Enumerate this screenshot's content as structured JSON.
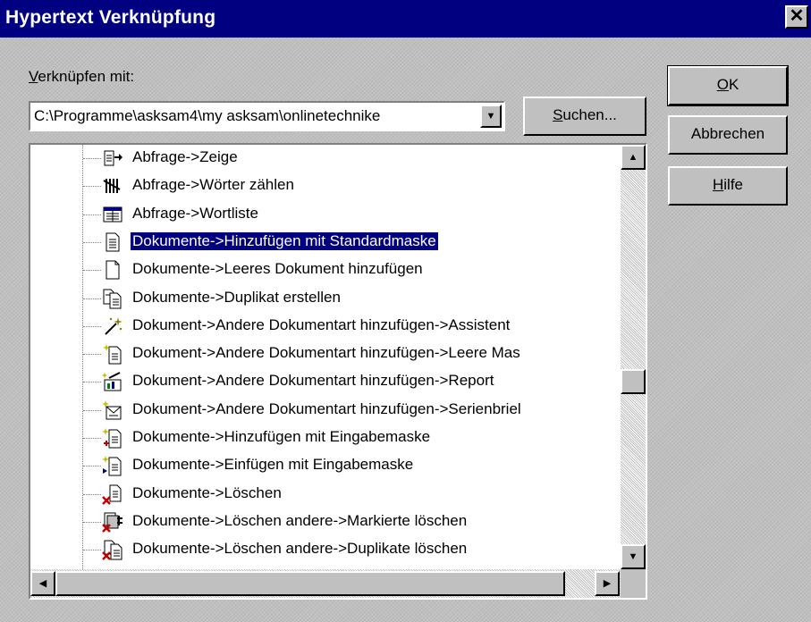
{
  "dialog": {
    "title": "Hypertext Verknüpfung",
    "close_glyph": "✕"
  },
  "verknuepfen": {
    "label": "Verknüpfen mit:",
    "value": "C:\\Programme\\asksam4\\my asksam\\onlinetechnike"
  },
  "buttons": {
    "ok": "OK",
    "abbrechen": "Abbrechen",
    "hilfe": "Hilfe",
    "suchen": "Suchen..."
  },
  "tree": {
    "selected_index": 3,
    "items": [
      {
        "label": "Abfrage->Zeige",
        "icon": "list-arrow-icon"
      },
      {
        "label": "Abfrage->Wörter zählen",
        "icon": "tally-icon"
      },
      {
        "label": "Abfrage->Wortliste",
        "icon": "wordlist-icon"
      },
      {
        "label": "Dokumente->Hinzufügen mit Standardmaske",
        "icon": "document-lines-icon"
      },
      {
        "label": "Dokumente->Leeres Dokument hinzufügen",
        "icon": "blank-document-icon"
      },
      {
        "label": "Dokumente->Duplikat erstellen",
        "icon": "duplicate-icon"
      },
      {
        "label": "Dokument->Andere Dokumentart hinzufügen->Assistent",
        "icon": "magic-wand-icon"
      },
      {
        "label": "Dokument->Andere Dokumentart hinzufügen->Leere Mas",
        "icon": "sparkle-document-icon"
      },
      {
        "label": "Dokument->Andere Dokumentart hinzufügen->Report",
        "icon": "report-icon"
      },
      {
        "label": "Dokument->Andere Dokumentart hinzufügen->Serienbriel",
        "icon": "mail-merge-icon"
      },
      {
        "label": "Dokumente->Hinzufügen mit Eingabemaske",
        "icon": "add-form-icon"
      },
      {
        "label": "Dokumente->Einfügen mit Eingabemaske",
        "icon": "insert-form-icon"
      },
      {
        "label": "Dokumente->Löschen",
        "icon": "delete-document-icon"
      },
      {
        "label": "Dokumente->Löschen andere->Markierte löschen",
        "icon": "delete-marked-icon"
      },
      {
        "label": "Dokumente->Löschen andere->Duplikate löschen",
        "icon": "delete-duplicates-icon"
      }
    ]
  },
  "scrollbars": {
    "vertical_position": 0.57,
    "up_glyph": "▲",
    "down_glyph": "▼",
    "left_glyph": "◀",
    "right_glyph": "▶"
  },
  "colors": {
    "title_bar": "#000080",
    "selection": "#000080",
    "face": "#c0c0c0"
  }
}
